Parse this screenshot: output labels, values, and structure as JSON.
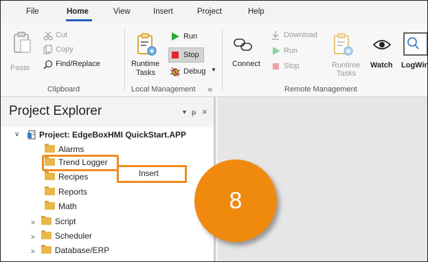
{
  "menu": {
    "tabs": [
      "File",
      "Home",
      "View",
      "Insert",
      "Project",
      "Help"
    ],
    "active": "Home"
  },
  "ribbon": {
    "clipboard": {
      "paste": "Paste",
      "cut": "Cut",
      "copy": "Copy",
      "find_replace": "Find/Replace",
      "label": "Clipboard"
    },
    "local": {
      "runtime": "Runtime",
      "tasks": "Tasks",
      "run": "Run",
      "stop": "Stop",
      "debug": "Debug",
      "label": "Local Management",
      "launcher_icon": "dialog-launcher-icon"
    },
    "remote": {
      "connect": "Connect",
      "download": "Download",
      "run": "Run",
      "stop": "Stop",
      "runtime": "Runtime",
      "tasks": "Tasks",
      "watch": "Watch",
      "logwin": "LogWin",
      "label": "Remote Management"
    }
  },
  "project_explorer": {
    "title": "Project Explorer",
    "pin": "p",
    "close": "×",
    "project_label": "Project: EdgeBoxHMI QuickStart.APP",
    "items": [
      {
        "label": "Alarms",
        "expandable": false
      },
      {
        "label": "Trend Logger",
        "expandable": false
      },
      {
        "label": "Recipes",
        "expandable": false
      },
      {
        "label": "Reports",
        "expandable": false
      },
      {
        "label": "Math",
        "expandable": false
      },
      {
        "label": "Script",
        "expandable": true
      },
      {
        "label": "Scheduler",
        "expandable": true
      },
      {
        "label": "Database/ERP",
        "expandable": true
      }
    ]
  },
  "context_menu": {
    "insert": "Insert"
  },
  "callout": {
    "step": "8"
  },
  "colors": {
    "accent_orange": "#ef8a0f",
    "tab_underline": "#1e5fb3",
    "run_green": "#2eaa3c",
    "stop_red": "#e0242f"
  }
}
